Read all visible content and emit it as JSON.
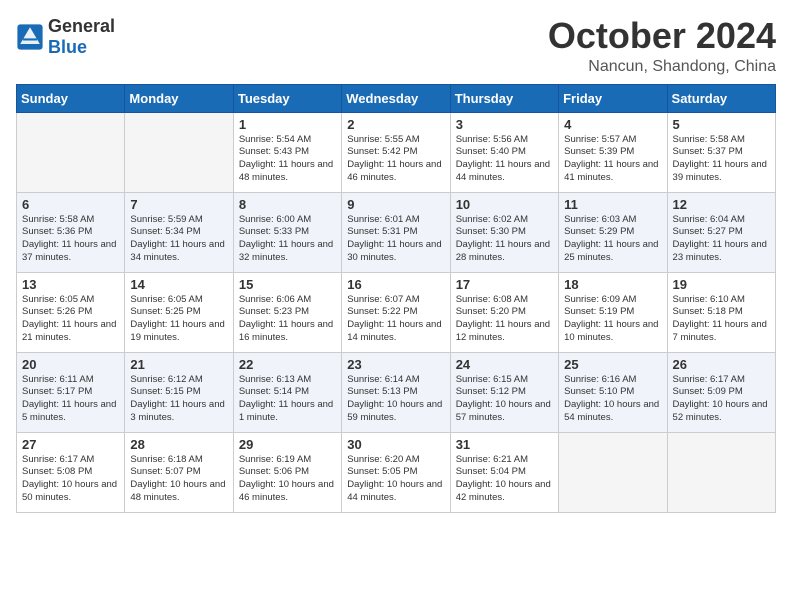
{
  "header": {
    "logo": {
      "general": "General",
      "blue": "Blue"
    },
    "title": "October 2024",
    "location": "Nancun, Shandong, China"
  },
  "weekdays": [
    "Sunday",
    "Monday",
    "Tuesday",
    "Wednesday",
    "Thursday",
    "Friday",
    "Saturday"
  ],
  "weeks": [
    [
      {
        "empty": true
      },
      {
        "empty": true
      },
      {
        "day": 1,
        "sunrise": "5:54 AM",
        "sunset": "5:43 PM",
        "daylight": "11 hours and 48 minutes."
      },
      {
        "day": 2,
        "sunrise": "5:55 AM",
        "sunset": "5:42 PM",
        "daylight": "11 hours and 46 minutes."
      },
      {
        "day": 3,
        "sunrise": "5:56 AM",
        "sunset": "5:40 PM",
        "daylight": "11 hours and 44 minutes."
      },
      {
        "day": 4,
        "sunrise": "5:57 AM",
        "sunset": "5:39 PM",
        "daylight": "11 hours and 41 minutes."
      },
      {
        "day": 5,
        "sunrise": "5:58 AM",
        "sunset": "5:37 PM",
        "daylight": "11 hours and 39 minutes."
      }
    ],
    [
      {
        "day": 6,
        "sunrise": "5:58 AM",
        "sunset": "5:36 PM",
        "daylight": "11 hours and 37 minutes."
      },
      {
        "day": 7,
        "sunrise": "5:59 AM",
        "sunset": "5:34 PM",
        "daylight": "11 hours and 34 minutes."
      },
      {
        "day": 8,
        "sunrise": "6:00 AM",
        "sunset": "5:33 PM",
        "daylight": "11 hours and 32 minutes."
      },
      {
        "day": 9,
        "sunrise": "6:01 AM",
        "sunset": "5:31 PM",
        "daylight": "11 hours and 30 minutes."
      },
      {
        "day": 10,
        "sunrise": "6:02 AM",
        "sunset": "5:30 PM",
        "daylight": "11 hours and 28 minutes."
      },
      {
        "day": 11,
        "sunrise": "6:03 AM",
        "sunset": "5:29 PM",
        "daylight": "11 hours and 25 minutes."
      },
      {
        "day": 12,
        "sunrise": "6:04 AM",
        "sunset": "5:27 PM",
        "daylight": "11 hours and 23 minutes."
      }
    ],
    [
      {
        "day": 13,
        "sunrise": "6:05 AM",
        "sunset": "5:26 PM",
        "daylight": "11 hours and 21 minutes."
      },
      {
        "day": 14,
        "sunrise": "6:05 AM",
        "sunset": "5:25 PM",
        "daylight": "11 hours and 19 minutes."
      },
      {
        "day": 15,
        "sunrise": "6:06 AM",
        "sunset": "5:23 PM",
        "daylight": "11 hours and 16 minutes."
      },
      {
        "day": 16,
        "sunrise": "6:07 AM",
        "sunset": "5:22 PM",
        "daylight": "11 hours and 14 minutes."
      },
      {
        "day": 17,
        "sunrise": "6:08 AM",
        "sunset": "5:20 PM",
        "daylight": "11 hours and 12 minutes."
      },
      {
        "day": 18,
        "sunrise": "6:09 AM",
        "sunset": "5:19 PM",
        "daylight": "11 hours and 10 minutes."
      },
      {
        "day": 19,
        "sunrise": "6:10 AM",
        "sunset": "5:18 PM",
        "daylight": "11 hours and 7 minutes."
      }
    ],
    [
      {
        "day": 20,
        "sunrise": "6:11 AM",
        "sunset": "5:17 PM",
        "daylight": "11 hours and 5 minutes."
      },
      {
        "day": 21,
        "sunrise": "6:12 AM",
        "sunset": "5:15 PM",
        "daylight": "11 hours and 3 minutes."
      },
      {
        "day": 22,
        "sunrise": "6:13 AM",
        "sunset": "5:14 PM",
        "daylight": "11 hours and 1 minute."
      },
      {
        "day": 23,
        "sunrise": "6:14 AM",
        "sunset": "5:13 PM",
        "daylight": "10 hours and 59 minutes."
      },
      {
        "day": 24,
        "sunrise": "6:15 AM",
        "sunset": "5:12 PM",
        "daylight": "10 hours and 57 minutes."
      },
      {
        "day": 25,
        "sunrise": "6:16 AM",
        "sunset": "5:10 PM",
        "daylight": "10 hours and 54 minutes."
      },
      {
        "day": 26,
        "sunrise": "6:17 AM",
        "sunset": "5:09 PM",
        "daylight": "10 hours and 52 minutes."
      }
    ],
    [
      {
        "day": 27,
        "sunrise": "6:17 AM",
        "sunset": "5:08 PM",
        "daylight": "10 hours and 50 minutes."
      },
      {
        "day": 28,
        "sunrise": "6:18 AM",
        "sunset": "5:07 PM",
        "daylight": "10 hours and 48 minutes."
      },
      {
        "day": 29,
        "sunrise": "6:19 AM",
        "sunset": "5:06 PM",
        "daylight": "10 hours and 46 minutes."
      },
      {
        "day": 30,
        "sunrise": "6:20 AM",
        "sunset": "5:05 PM",
        "daylight": "10 hours and 44 minutes."
      },
      {
        "day": 31,
        "sunrise": "6:21 AM",
        "sunset": "5:04 PM",
        "daylight": "10 hours and 42 minutes."
      },
      {
        "empty": true
      },
      {
        "empty": true
      }
    ]
  ]
}
